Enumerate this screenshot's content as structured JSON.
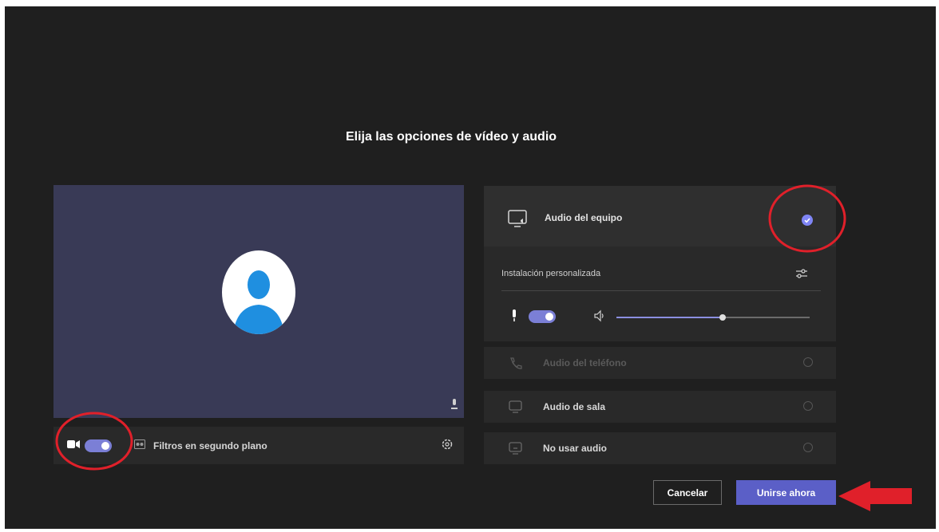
{
  "title": "Elija las opciones de vídeo y audio",
  "video": {
    "camera_toggle_on": true,
    "background_filters_label": "Filtros en segundo plano"
  },
  "audio": {
    "computer_audio_label": "Audio del equipo",
    "computer_audio_selected": true,
    "custom_setup_label": "Instalación personalizada",
    "mic_toggle_on": true,
    "speaker_volume": 0.55,
    "options": [
      {
        "label": "Audio del teléfono",
        "disabled": true
      },
      {
        "label": "Audio de sala",
        "disabled": false
      },
      {
        "label": "No usar audio",
        "disabled": false
      }
    ]
  },
  "buttons": {
    "cancel_label": "Cancelar",
    "join_label": "Unirse ahora"
  },
  "colors": {
    "background": "#1f1f1f",
    "accent": "#5b5fc7",
    "annotation": "#e0202a"
  }
}
